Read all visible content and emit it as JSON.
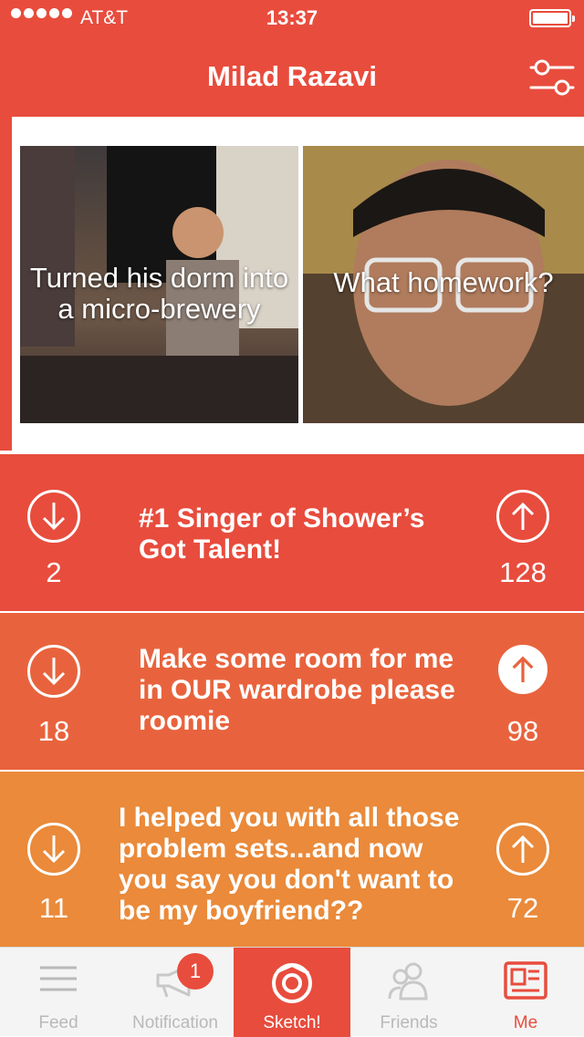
{
  "status_bar": {
    "carrier": "AT&T",
    "time": "13:37"
  },
  "header": {
    "title": "Milad Razavi",
    "settings_icon": "sliders-icon"
  },
  "photos": [
    {
      "caption": "Turned his dorm into a micro-brewery"
    },
    {
      "caption": "What homework?"
    }
  ],
  "cards": [
    {
      "text": "#1 Singer of Shower’s Got Talent!",
      "down_count": "2",
      "up_count": "128",
      "color": "#e84c3d"
    },
    {
      "text": "Make some room for me in OUR wardrobe please roomie",
      "down_count": "18",
      "up_count": "98",
      "color": "#e8633d"
    },
    {
      "text": "I helped you with all those problem sets...and now you say you don't want to be my boyfriend??",
      "down_count": "11",
      "up_count": "72",
      "color": "#ea8a3a"
    }
  ],
  "tabs": [
    {
      "label": "Feed",
      "icon": "list-icon"
    },
    {
      "label": "Notification",
      "icon": "megaphone-icon",
      "badge": "1"
    },
    {
      "label": "Sketch!",
      "icon": "camera-icon",
      "active": true
    },
    {
      "label": "Friends",
      "icon": "people-icon"
    },
    {
      "label": "Me",
      "icon": "profile-card-icon"
    }
  ],
  "colors": {
    "brand": "#e84c3d",
    "tab_inactive": "#b9b9b9",
    "tab_background": "#f4f4f4"
  }
}
